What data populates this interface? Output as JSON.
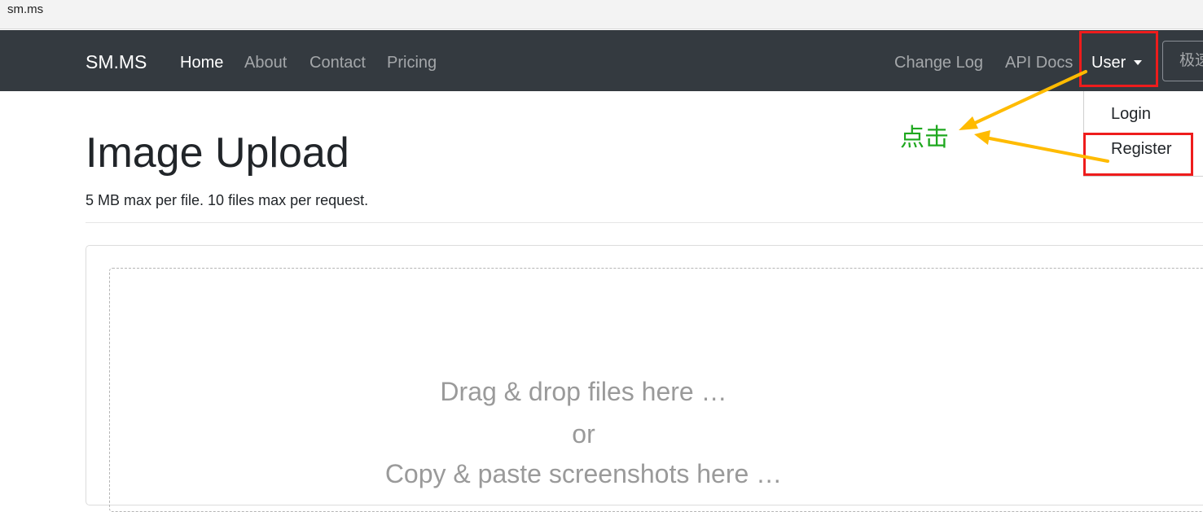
{
  "browser": {
    "url": "sm.ms"
  },
  "navbar": {
    "brand": "SM.MS",
    "left_links": [
      "Home",
      "About",
      "Contact",
      "Pricing"
    ],
    "right_links": [
      "Change Log",
      "API Docs"
    ],
    "user_label": "User",
    "language_label": "极速"
  },
  "dropdown": {
    "items": [
      "Login",
      "Register"
    ]
  },
  "annotation": {
    "text": "点击",
    "highlight_color": "#ee1c1c",
    "arrow_color": "#ffbb00",
    "text_color": "#1fa81f"
  },
  "page": {
    "title": "Image Upload",
    "subtitle": "5 MB max per file. 10 files max per request."
  },
  "dropzone": {
    "line1": "Drag & drop files here …",
    "line2": "or",
    "line3": "Copy & paste screenshots here …"
  },
  "colors": {
    "navbar_bg": "#343a40",
    "accent": "#ffffff"
  }
}
